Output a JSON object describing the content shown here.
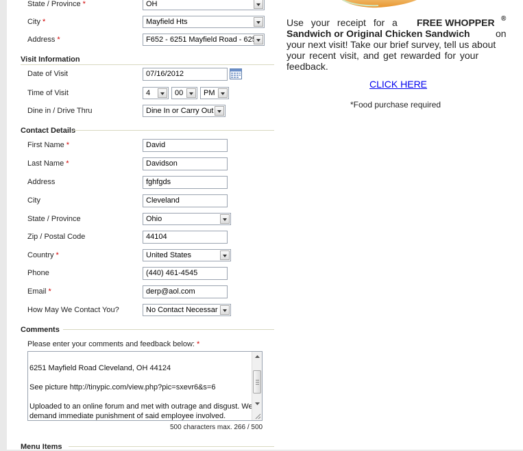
{
  "location": {
    "state_label": "State / Province",
    "state_value": "OH",
    "city_label": "City",
    "city_value": "Mayfield Hts",
    "address_label": "Address",
    "address_value": "F652 - 6251 Mayfield Road - 625"
  },
  "visit": {
    "section_title": "Visit Information",
    "date_label": "Date of Visit",
    "date_value": "07/16/2012",
    "time_label": "Time of Visit",
    "hour": "4",
    "minute": "00",
    "ampm": "PM",
    "dine_label": "Dine in / Drive Thru",
    "dine_value": "Dine In or Carry Out"
  },
  "contact": {
    "section_title": "Contact Details",
    "first_name_label": "First Name",
    "first_name": "David",
    "last_name_label": "Last Name",
    "last_name": "Davidson",
    "address_label": "Address",
    "address": "fghfgds",
    "city_label": "City",
    "city": "Cleveland",
    "state_label": "State / Province",
    "state": "Ohio",
    "zip_label": "Zip / Postal Code",
    "zip": "44104",
    "country_label": "Country",
    "country": "United States",
    "phone_label": "Phone",
    "phone": "(440) 461-4545",
    "email_label": "Email",
    "email": "derp@aol.com",
    "contact_method_label": "How May We Contact You?",
    "contact_method": "No Contact Necessar"
  },
  "comments": {
    "section_title": "Comments",
    "prompt": "Please enter your comments and feedback below:",
    "line1": "6251 Mayfield Road Cleveland, OH 44124",
    "line2": "See picture http://tinypic.com/view.php?pic=sxevr6&s=6",
    "line3": "Uploaded to an online forum and met with outrage and disgust. We",
    "line4": "demand immediate punishment of said employee involved.",
    "counter": "500 characters max. 266 / 500"
  },
  "menu": {
    "section_title": "Menu Items"
  },
  "promo": {
    "line1_pre": "Use your receipt for a",
    "line1_bold": "FREE WHOPPER",
    "reg": "®",
    "line2_bold": "Sandwich or Original Chicken Sandwich",
    "line2_post": "on",
    "line3": "your next visit! Take our brief survey, tell us about",
    "line4": "your recent visit, and get rewarded for your",
    "line5": "feedback.",
    "link": "CLICK HERE",
    "note": "*Food purchase required"
  },
  "required_marker": "*",
  "colors": {
    "required": "#d00000",
    "link": "#0000ee",
    "section_rule": "#d8d8c0"
  }
}
